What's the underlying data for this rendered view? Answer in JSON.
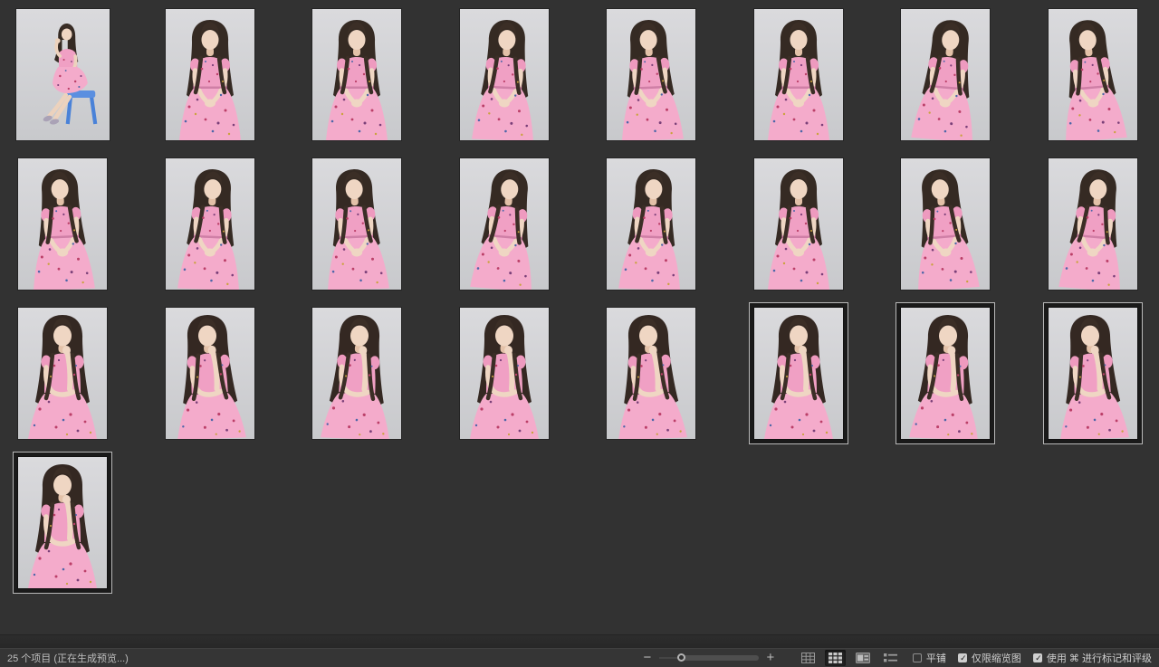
{
  "window": {
    "background": "#323232"
  },
  "grid": {
    "item_total": 25,
    "items": [
      {
        "pose": "seated-stool-full",
        "selected": false,
        "wide": true,
        "lean": 0
      },
      {
        "pose": "seated-hands-lap",
        "selected": false,
        "lean": 0
      },
      {
        "pose": "seated-hands-lap",
        "selected": false,
        "lean": 0
      },
      {
        "pose": "seated-hands-lap",
        "selected": false,
        "lean": 1
      },
      {
        "pose": "seated-hands-lap",
        "selected": false,
        "lean": -1
      },
      {
        "pose": "seated-hands-lap",
        "selected": false,
        "lean": 0
      },
      {
        "pose": "seated-hands-lap",
        "selected": false,
        "lean": 2
      },
      {
        "pose": "seated-hands-lap",
        "selected": false,
        "lean": -2
      },
      {
        "pose": "seated-hands-lap",
        "selected": false,
        "lean": -1
      },
      {
        "pose": "seated-hands-lap",
        "selected": false,
        "lean": 1
      },
      {
        "pose": "seated-hands-lap",
        "selected": false,
        "lean": -1
      },
      {
        "pose": "seated-hands-lap",
        "selected": false,
        "lean": 2
      },
      {
        "pose": "seated-hands-lap",
        "selected": false,
        "lean": 1
      },
      {
        "pose": "seated-hands-lap",
        "selected": false,
        "lean": 0
      },
      {
        "pose": "seated-hands-lap",
        "selected": false,
        "lean": -2
      },
      {
        "pose": "seated-hands-lap",
        "selected": false,
        "lean": 2
      },
      {
        "pose": "chin-pose",
        "selected": false,
        "lean": 0
      },
      {
        "pose": "chin-pose",
        "selected": false,
        "lean": -1
      },
      {
        "pose": "chin-pose",
        "selected": false,
        "lean": 1
      },
      {
        "pose": "chin-pose",
        "selected": false,
        "lean": 0
      },
      {
        "pose": "chin-pose",
        "selected": false,
        "lean": -1
      },
      {
        "pose": "chin-pose",
        "selected": true,
        "lean": 0
      },
      {
        "pose": "chin-pose",
        "selected": true,
        "lean": 1
      },
      {
        "pose": "chin-pose",
        "selected": true,
        "lean": -1
      },
      {
        "pose": "chin-pose",
        "selected": true,
        "lean": 0
      }
    ]
  },
  "status_bar": {
    "item_count_text": "25 个项目 (正在生成预览...)",
    "zoom": {
      "out_icon": "−",
      "in_icon": "+",
      "slider_percent": 22
    },
    "view_buttons": [
      {
        "name": "grid-lock",
        "active": false
      },
      {
        "name": "thumbnail-grid-view",
        "active": true
      },
      {
        "name": "details-view",
        "active": false
      },
      {
        "name": "list-view",
        "active": false
      }
    ],
    "checkboxes": [
      {
        "label": "平铺",
        "checked": false
      },
      {
        "label": "仅限缩览图",
        "checked": true
      },
      {
        "label": "使用 ⌘ 进行标记和评级",
        "checked": true
      }
    ]
  },
  "colors": {
    "selection_outline": "#b9b9b9",
    "photo_bg_top": "#dadadd",
    "photo_bg_bottom": "#c8c9cc",
    "dress_pink": "#f0a0c4",
    "stool_blue": "#5b8fe0"
  }
}
